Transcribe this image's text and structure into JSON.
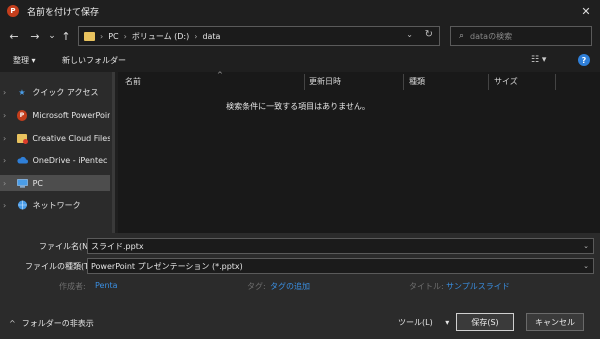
{
  "window": {
    "icon": "powerpoint-icon",
    "title": "名前を付けて保存",
    "close_glyph": "✕"
  },
  "nav": {
    "back_glyph": "←",
    "forward_glyph": "→",
    "recent_glyph": "⌄",
    "up_glyph": "↑",
    "breadcrumb": [
      "PC",
      "ボリューム (D:)",
      "data"
    ],
    "refresh_glyph": "↻",
    "search_placeholder": "dataの検索"
  },
  "toolbar": {
    "organize": "整理 ▾",
    "new_folder": "新しいフォルダー",
    "view_glyph": "☷ ▾",
    "help_glyph": "?"
  },
  "sidebar": {
    "items": [
      {
        "label": "クイック アクセス",
        "icon": "star-icon",
        "color": "#4a9de8"
      },
      {
        "label": "Microsoft PowerPoin",
        "icon": "powerpoint-icon",
        "color": "#c43e1c"
      },
      {
        "label": "Creative Cloud Files",
        "icon": "creative-cloud-icon",
        "color": "#e8c25e"
      },
      {
        "label": "OneDrive - iPentec",
        "icon": "cloud-icon",
        "color": "#2f7fd8"
      },
      {
        "label": "PC",
        "icon": "computer-icon",
        "color": "#4a9de8"
      },
      {
        "label": "ネットワーク",
        "icon": "network-icon",
        "color": "#4a9de8"
      }
    ],
    "selected_index": 4
  },
  "filelist": {
    "columns": [
      "名前",
      "更新日時",
      "種類",
      "サイズ"
    ],
    "sort_glyph": "^",
    "empty_message": "検索条件に一致する項目はありません。"
  },
  "form": {
    "filename_label": "ファイル名(N):",
    "filename_value": "スライド.pptx",
    "filetype_label": "ファイルの種類(T):",
    "filetype_value": "PowerPoint プレゼンテーション (*.pptx)",
    "author_label": "作成者:",
    "author_value": "Penta",
    "tags_label": "タグ:",
    "tags_value": "タグの追加",
    "title_label": "タイトル:",
    "title_value": "サンプルスライド"
  },
  "footer": {
    "hide_folders": "フォルダーの非表示",
    "tools": "ツール(L)",
    "tools_glyph": "▾",
    "save": "保存(S)",
    "cancel": "キャンセル"
  },
  "colors": {
    "accent": "#3a8ee0",
    "folder": "#e8c25e",
    "powerpoint": "#c43e1c"
  }
}
